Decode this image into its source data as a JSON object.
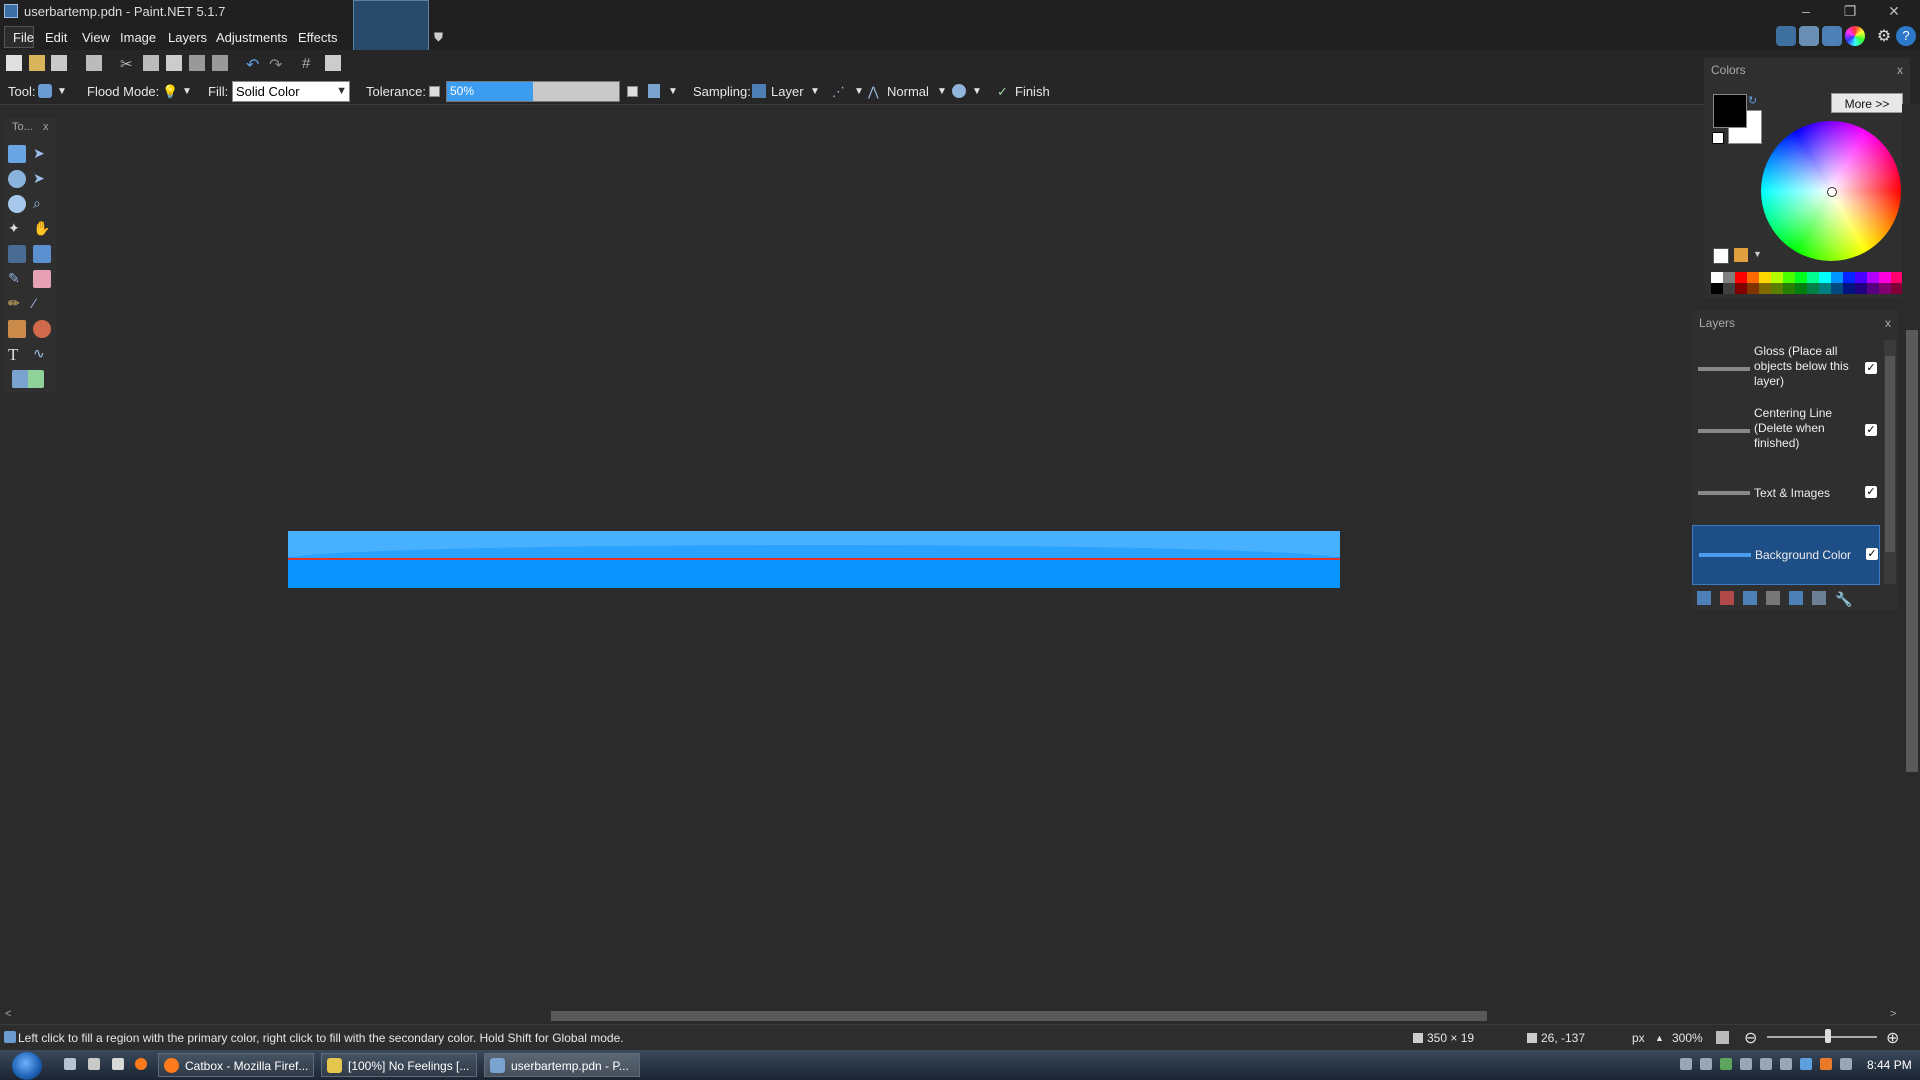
{
  "window": {
    "title": "userbartemp.pdn - Paint.NET 5.1.7",
    "controls": [
      "–",
      "❐",
      "✕"
    ]
  },
  "menu": [
    "File",
    "Edit",
    "View",
    "Image",
    "Layers",
    "Adjustments",
    "Effects"
  ],
  "toolbar": {
    "tool_label": "Tool:",
    "flood_mode_label": "Flood Mode:",
    "fill_label": "Fill:",
    "fill_value": "Solid Color",
    "tolerance_label": "Tolerance:",
    "tolerance_value": "50%",
    "tolerance_percent": 50,
    "sampling_label": "Sampling:",
    "sampling_value": "Layer",
    "blend_mode": "Normal",
    "finish_label": "Finish"
  },
  "tools_panel": {
    "title": "To...",
    "close": "x"
  },
  "colors_panel": {
    "title": "Colors",
    "close": "x",
    "more_button": "More >>",
    "primary_color": "#000000",
    "secondary_color": "#ffffff"
  },
  "layers_panel": {
    "title": "Layers",
    "close": "x",
    "layers": [
      {
        "name": "Gloss (Place all objects below this layer)",
        "visible": true,
        "selected": false
      },
      {
        "name": "Centering Line (Delete when finished)",
        "visible": true,
        "selected": false
      },
      {
        "name": "Text & Images",
        "visible": true,
        "selected": false
      },
      {
        "name": "Background Color",
        "visible": true,
        "selected": true
      }
    ]
  },
  "status": {
    "hint": "Left click to fill a region with the primary color, right click to fill with the secondary color. Hold Shift for Global mode.",
    "image_size": "350 × 19",
    "cursor_pos": "26, -137",
    "units": "px",
    "zoom": "300%"
  },
  "taskbar": {
    "buttons": [
      "Catbox - Mozilla Firef...",
      "[100%] No Feelings [...",
      "userbartemp.pdn - P..."
    ],
    "clock": "8:44 PM"
  },
  "colors": {
    "accent": "#1e8fff",
    "canvas_blue": "#0a94ff",
    "center_line": "#e8332d"
  }
}
